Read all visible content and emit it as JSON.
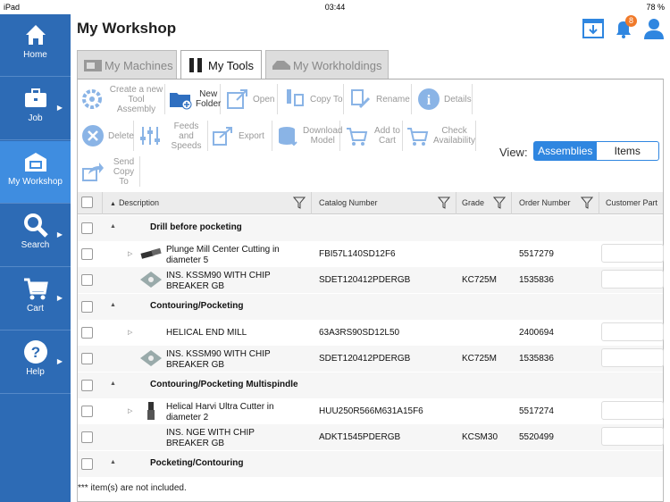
{
  "status": {
    "left": "iPad",
    "time": "03:44",
    "battery": "78 %"
  },
  "sidebar": [
    {
      "label": "Home",
      "icon": "home-icon"
    },
    {
      "label": "Job",
      "icon": "briefcase-icon"
    },
    {
      "label": "My Workshop",
      "icon": "workshop-icon"
    },
    {
      "label": "Search",
      "icon": "search-icon"
    },
    {
      "label": "Cart",
      "icon": "cart-icon"
    },
    {
      "label": "Help",
      "icon": "help-icon"
    }
  ],
  "header": {
    "title": "My Workshop",
    "notification_count": "8"
  },
  "tabs": [
    "My Machines",
    "My Tools",
    "My Workholdings"
  ],
  "toolbar": {
    "create": "Create a new Tool Assembly",
    "new_folder": "New Folder",
    "open": "Open",
    "copy_to": "Copy To",
    "rename": "Rename",
    "details": "Details",
    "delete": "Delete",
    "feeds": "Feeds and Speeds",
    "export": "Export",
    "download": "Download Model",
    "add_cart": "Add to Cart",
    "check": "Check Availability",
    "send": "Send Copy To"
  },
  "view": {
    "label": "View:",
    "assemblies": "Assemblies",
    "items": "Items"
  },
  "table": {
    "headers": {
      "description": "Description",
      "catalog": "Catalog Number",
      "grade": "Grade",
      "order": "Order Number",
      "customer": "Customer Part"
    },
    "groups": [
      {
        "title": "Drill before pocketing",
        "rows": [
          {
            "desc": "Plunge Mill Center Cutting in diameter 5",
            "cat": "FBI57L140SD12F6",
            "grade": "",
            "order": "5517279"
          },
          {
            "desc": "INS. KSSM90 WITH CHIP BREAKER GB",
            "cat": "SDET120412PDERGB",
            "grade": "KC725M",
            "order": "1535836"
          }
        ]
      },
      {
        "title": "Contouring/Pocketing",
        "rows": [
          {
            "desc": "HELICAL END MILL",
            "cat": "63A3RS90SD12L50",
            "grade": "",
            "order": "2400694"
          },
          {
            "desc": "INS. KSSM90 WITH CHIP BREAKER GB",
            "cat": "SDET120412PDERGB",
            "grade": "KC725M",
            "order": "1535836"
          }
        ]
      },
      {
        "title": "Contouring/Pocketing Multispindle",
        "rows": [
          {
            "desc": "Helical Harvi Ultra Cutter in diameter 2",
            "cat": "HUU250R566M631A15F6",
            "grade": "",
            "order": "5517274"
          },
          {
            "desc": "INS. NGE WITH CHIP BREAKER GB",
            "cat": "ADKT1545PDERGB",
            "grade": "KCSM30",
            "order": "5520499"
          }
        ]
      },
      {
        "title": "Pocketing/Contouring",
        "rows": []
      }
    ]
  },
  "footer": "*** item(s) are not included."
}
